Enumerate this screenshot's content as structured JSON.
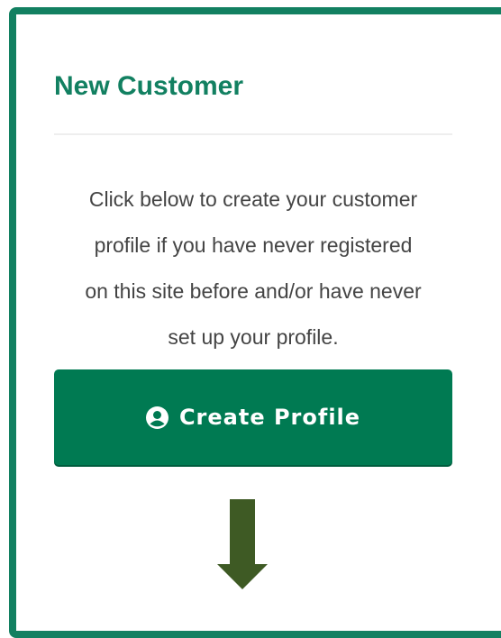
{
  "card": {
    "title": "New Customer",
    "description_lines": [
      "Click below to create your customer",
      "profile if you have never registered",
      "on this site before and/or have never",
      "set up your profile."
    ],
    "button": {
      "label": "Create Profile",
      "icon": "user-circle-icon"
    },
    "arrow_icon": "arrow-down-icon"
  },
  "colors": {
    "accent": "#128061",
    "button": "#007a52",
    "arrow": "#3e5a24",
    "text": "#444444"
  }
}
